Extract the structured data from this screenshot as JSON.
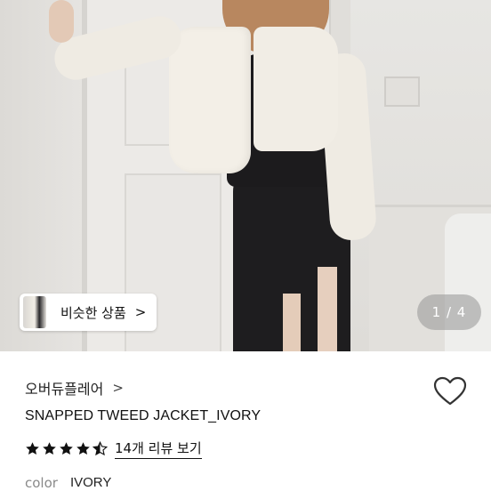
{
  "gallery": {
    "similar_button_label": "비슷한 상품",
    "similar_button_arrow": ">",
    "pager_text": "1 / 4"
  },
  "product": {
    "brand": "오버듀플레어",
    "brand_arrow": ">",
    "name": "SNAPPED TWEED JACKET_IVORY",
    "rating": 4.5,
    "review_link": "14개 리뷰 보기",
    "option_label": "color",
    "option_value": "IVORY"
  },
  "icons": {
    "like": "heart-outline-icon",
    "star": "star-icon"
  },
  "colors": {
    "text": "#111111",
    "muted": "#8a8a8a",
    "pager_bg": "#969696"
  }
}
